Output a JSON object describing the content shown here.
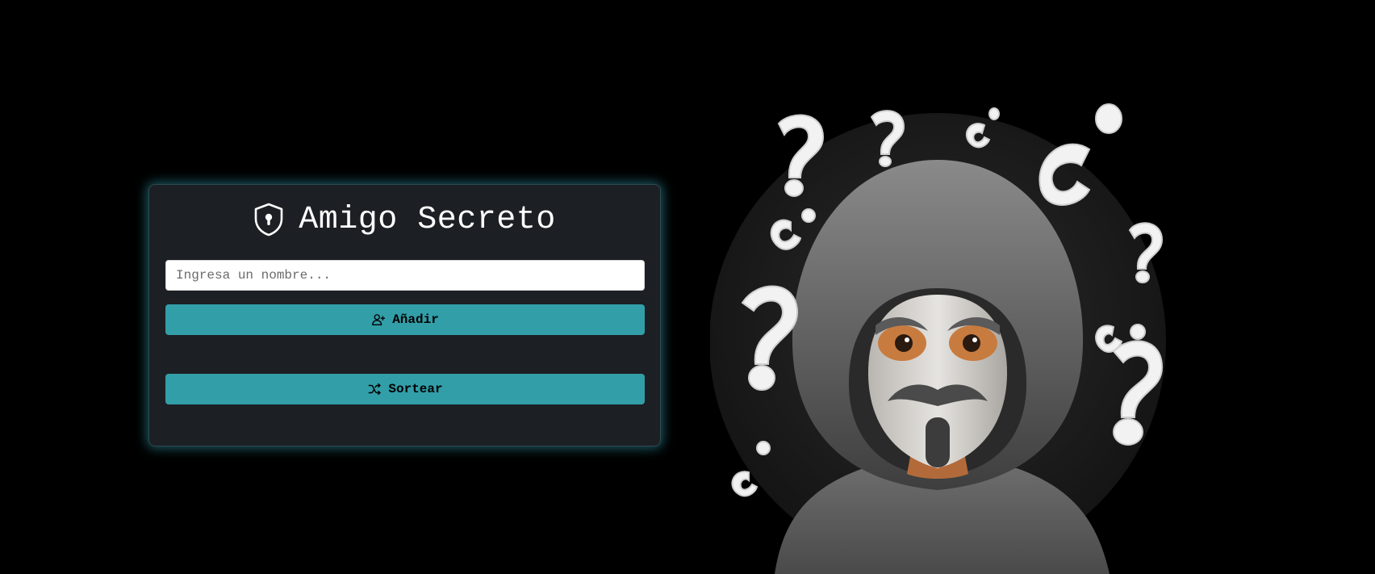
{
  "card": {
    "title": "Amigo Secreto",
    "title_icon": "shield-keyhole-icon",
    "input": {
      "placeholder": "Ingresa un nombre...",
      "value": ""
    },
    "add_button": {
      "label": "Añadir",
      "icon": "user-plus-icon"
    },
    "draw_button": {
      "label": "Sortear",
      "icon": "shuffle-icon"
    }
  },
  "colors": {
    "background": "#000000",
    "card_background": "#1c1f24",
    "accent": "#329ea8",
    "glow": "#34aab9"
  },
  "illustration": {
    "subject": "hooded-masked-figure-with-question-marks"
  }
}
